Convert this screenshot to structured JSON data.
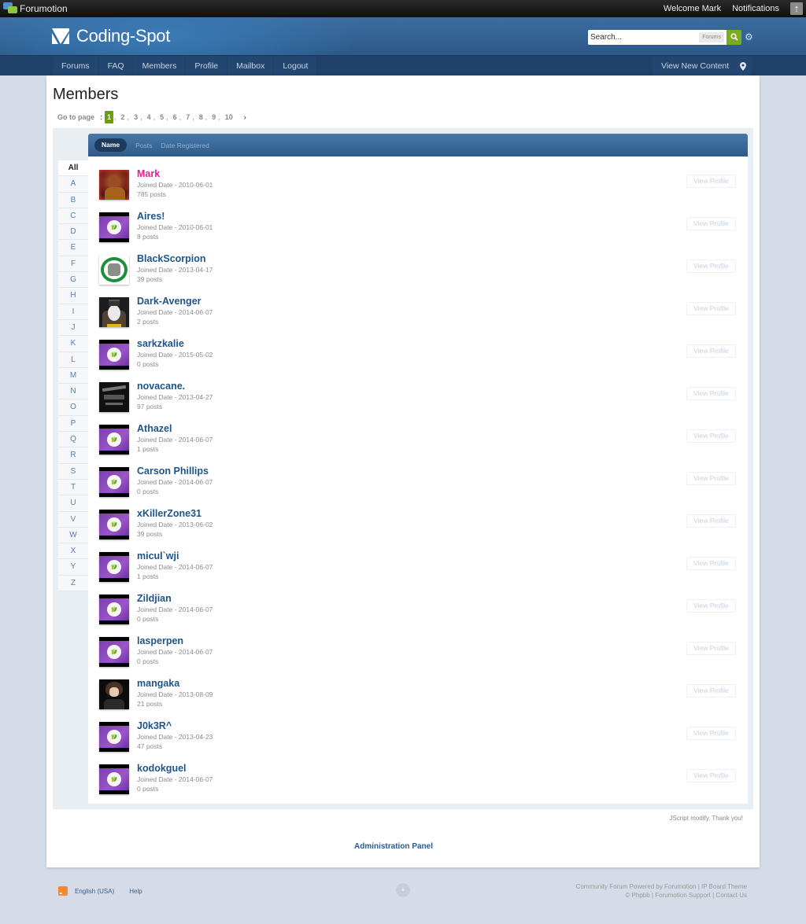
{
  "topbar": {
    "brand": "Forumotion",
    "welcome": "Welcome Mark",
    "notifications": "Notifications",
    "scroll_top_icon": "arrow-up-icon"
  },
  "header": {
    "site_name": "Coding-Spot",
    "search": {
      "placeholder": "Search...",
      "value": "Search...",
      "scope": "Forums"
    },
    "search_icon": "search-icon",
    "settings_icon": "gear-icon"
  },
  "nav": {
    "items": [
      "Forums",
      "FAQ",
      "Members",
      "Profile",
      "Mailbox",
      "Logout"
    ],
    "view_new_content": "View New Content",
    "map_icon": "map-pin-icon"
  },
  "page": {
    "title": "Members",
    "pagination": {
      "label": "Go to page",
      "current": "1",
      "pages": [
        "1",
        "2",
        "3",
        "4",
        "5",
        "6",
        "7",
        "8",
        "9",
        "10"
      ],
      "next": "›"
    },
    "sort_tabs": [
      {
        "label": "Name",
        "active": true
      },
      {
        "label": "Posts",
        "active": false
      },
      {
        "label": "Date Registered",
        "active": false
      }
    ],
    "letters": [
      "All",
      "A",
      "B",
      "C",
      "D",
      "E",
      "F",
      "G",
      "H",
      "I",
      "J",
      "K",
      "L",
      "M",
      "N",
      "O",
      "P",
      "Q",
      "R",
      "S",
      "T",
      "U",
      "V",
      "W",
      "X",
      "Y",
      "Z"
    ],
    "view_profile_label": "View Profile",
    "members": [
      {
        "name": "Mark",
        "joined": "Joined Date - 2010-06-01",
        "posts": "785 posts",
        "role": "admin",
        "avatar": "custom-mark"
      },
      {
        "name": "Aires!",
        "joined": "Joined Date - 2010-06-01",
        "posts": "8 posts",
        "role": "member",
        "avatar": "default"
      },
      {
        "name": "BlackScorpion",
        "joined": "Joined Date - 2013-04-17",
        "posts": "39 posts",
        "role": "member",
        "avatar": "custom-scorpion"
      },
      {
        "name": "Dark-Avenger",
        "joined": "Joined Date - 2014-06-07",
        "posts": "2 posts",
        "role": "member",
        "avatar": "custom-penguin"
      },
      {
        "name": "sarkzkalie",
        "joined": "Joined Date - 2015-05-02",
        "posts": "0 posts",
        "role": "member",
        "avatar": "default"
      },
      {
        "name": "novacane.",
        "joined": "Joined Date - 2013-04-27",
        "posts": "97 posts",
        "role": "member",
        "avatar": "custom-nova"
      },
      {
        "name": "Athazel",
        "joined": "Joined Date - 2014-06-07",
        "posts": "1 posts",
        "role": "member",
        "avatar": "default"
      },
      {
        "name": "Carson Phillips",
        "joined": "Joined Date - 2014-06-07",
        "posts": "0 posts",
        "role": "member",
        "avatar": "default"
      },
      {
        "name": "xKillerZone31",
        "joined": "Joined Date - 2013-06-02",
        "posts": "39 posts",
        "role": "member",
        "avatar": "default"
      },
      {
        "name": "micul`wji",
        "joined": "Joined Date - 2014-06-07",
        "posts": "1 posts",
        "role": "member",
        "avatar": "default"
      },
      {
        "name": "Zildjian",
        "joined": "Joined Date - 2014-06-07",
        "posts": "0 posts",
        "role": "member",
        "avatar": "default"
      },
      {
        "name": "lasperpen",
        "joined": "Joined Date - 2014-06-07",
        "posts": "0 posts",
        "role": "member",
        "avatar": "default"
      },
      {
        "name": "mangaka",
        "joined": "Joined Date - 2013-08-09",
        "posts": "21 posts",
        "role": "member",
        "avatar": "custom-manga"
      },
      {
        "name": "J0k3R^",
        "joined": "Joined Date - 2013-04-23",
        "posts": "47 posts",
        "role": "member",
        "avatar": "default"
      },
      {
        "name": "kodokguel",
        "joined": "Joined Date - 2014-06-07",
        "posts": "0 posts",
        "role": "member",
        "avatar": "default"
      }
    ],
    "jscript_note": "JScript modify. Thank you!",
    "admin_panel": "Administration Panel"
  },
  "footer": {
    "language": "English (USA)",
    "help": "Help",
    "rss_icon": "rss-icon",
    "credits_line1": "Community Forum Powered by Forumotion | IP Board Theme",
    "credits_line2": "© Phpbb | Forumotion Support | Contact Us"
  },
  "colors": {
    "admin_name": "#e0248a",
    "member_name": "#1e5487",
    "current_page": "#6b9d12",
    "search_button": "#7bab1f",
    "nav_bg": "#1f4068"
  }
}
